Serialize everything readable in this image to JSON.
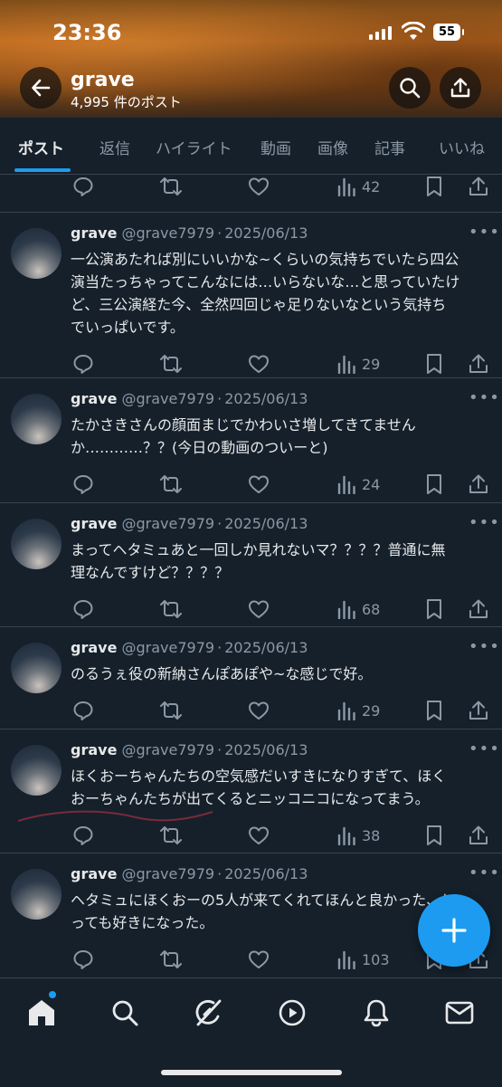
{
  "status_bar": {
    "time": "23:36",
    "battery": "55"
  },
  "header": {
    "title": "grave",
    "subtitle": "4,995 件のポスト"
  },
  "tabs": [
    "ポスト",
    "返信",
    "ハイライト",
    "動画",
    "画像",
    "記事",
    "いいね"
  ],
  "partial_post": {
    "views": "42"
  },
  "posts": [
    {
      "name": "grave",
      "handle": "@grave7979",
      "separator": "·",
      "date": "2025/06/13",
      "lines": [
        "一公演あたれば別にいいかな~くらいの気持ちでいたら四公",
        "演当たっちゃってこんなには…いらないな…と思っていたけ",
        "ど、三公演経た今、全然四回じゃ足りないなという気持ち",
        "でいっぱいです。"
      ],
      "views": "29"
    },
    {
      "name": "grave",
      "handle": "@grave7979",
      "separator": "·",
      "date": "2025/06/13",
      "lines": [
        "たかさきさんの顔面まじでかわいさ増してきてません",
        "か…………？？(今日の動画のついーと)"
      ],
      "views": "24"
    },
    {
      "name": "grave",
      "handle": "@grave7979",
      "separator": "·",
      "date": "2025/06/13",
      "lines": [
        "まってヘタミュあと一回しか見れないマ？？？？普通に無",
        "理なんですけど？？？？"
      ],
      "views": "68"
    },
    {
      "name": "grave",
      "handle": "@grave7979",
      "separator": "·",
      "date": "2025/06/13",
      "lines": [
        "のるうぇ役の新納さんぽあぽや~な感じで好。"
      ],
      "views": "29"
    },
    {
      "name": "grave",
      "handle": "@grave7979",
      "separator": "·",
      "date": "2025/06/13",
      "lines": [
        "ほくおーちゃんたちの空気感だいすきになりすぎて、ほく",
        "おーちゃんたちが出てくるとニッコニコになってまう。"
      ],
      "views": "38"
    },
    {
      "name": "grave",
      "handle": "@grave7979",
      "separator": "·",
      "date": "2025/06/13",
      "lines": [
        "ヘタミュにほくおーの5人が来てくれてほんと良かった、と",
        "っても好きになった。"
      ],
      "views": "103"
    }
  ],
  "icons": {
    "header": [
      "back-arrow-icon",
      "search-icon",
      "share-icon"
    ],
    "actions": [
      "reply-icon",
      "repost-icon",
      "like-icon",
      "views-icon",
      "bookmark-icon",
      "share-icon"
    ],
    "nav": [
      "home-icon",
      "search-icon",
      "grok-icon",
      "video-icon",
      "bell-icon",
      "mail-icon"
    ]
  },
  "colors": {
    "background": "#15202b",
    "accent": "#1d9bf0",
    "muted": "#8b98a5",
    "text": "#e7e9ea"
  }
}
